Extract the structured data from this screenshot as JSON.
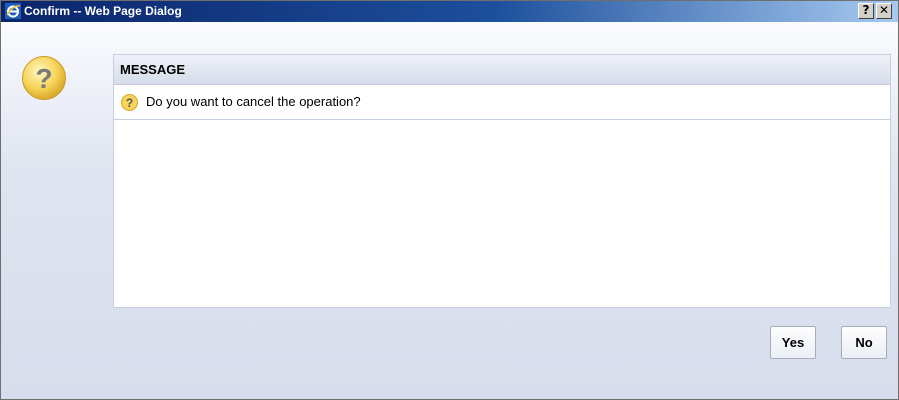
{
  "window": {
    "title": "Confirm -- Web Page Dialog",
    "help_button_label": "?",
    "close_button_label": "✕"
  },
  "panel": {
    "header": "MESSAGE",
    "message": "Do you want to cancel the operation?"
  },
  "buttons": {
    "yes": "Yes",
    "no": "No"
  },
  "colors": {
    "titlebar_start": "#0a246a",
    "titlebar_end": "#a6caf0",
    "question_icon": "#f2c94c"
  }
}
